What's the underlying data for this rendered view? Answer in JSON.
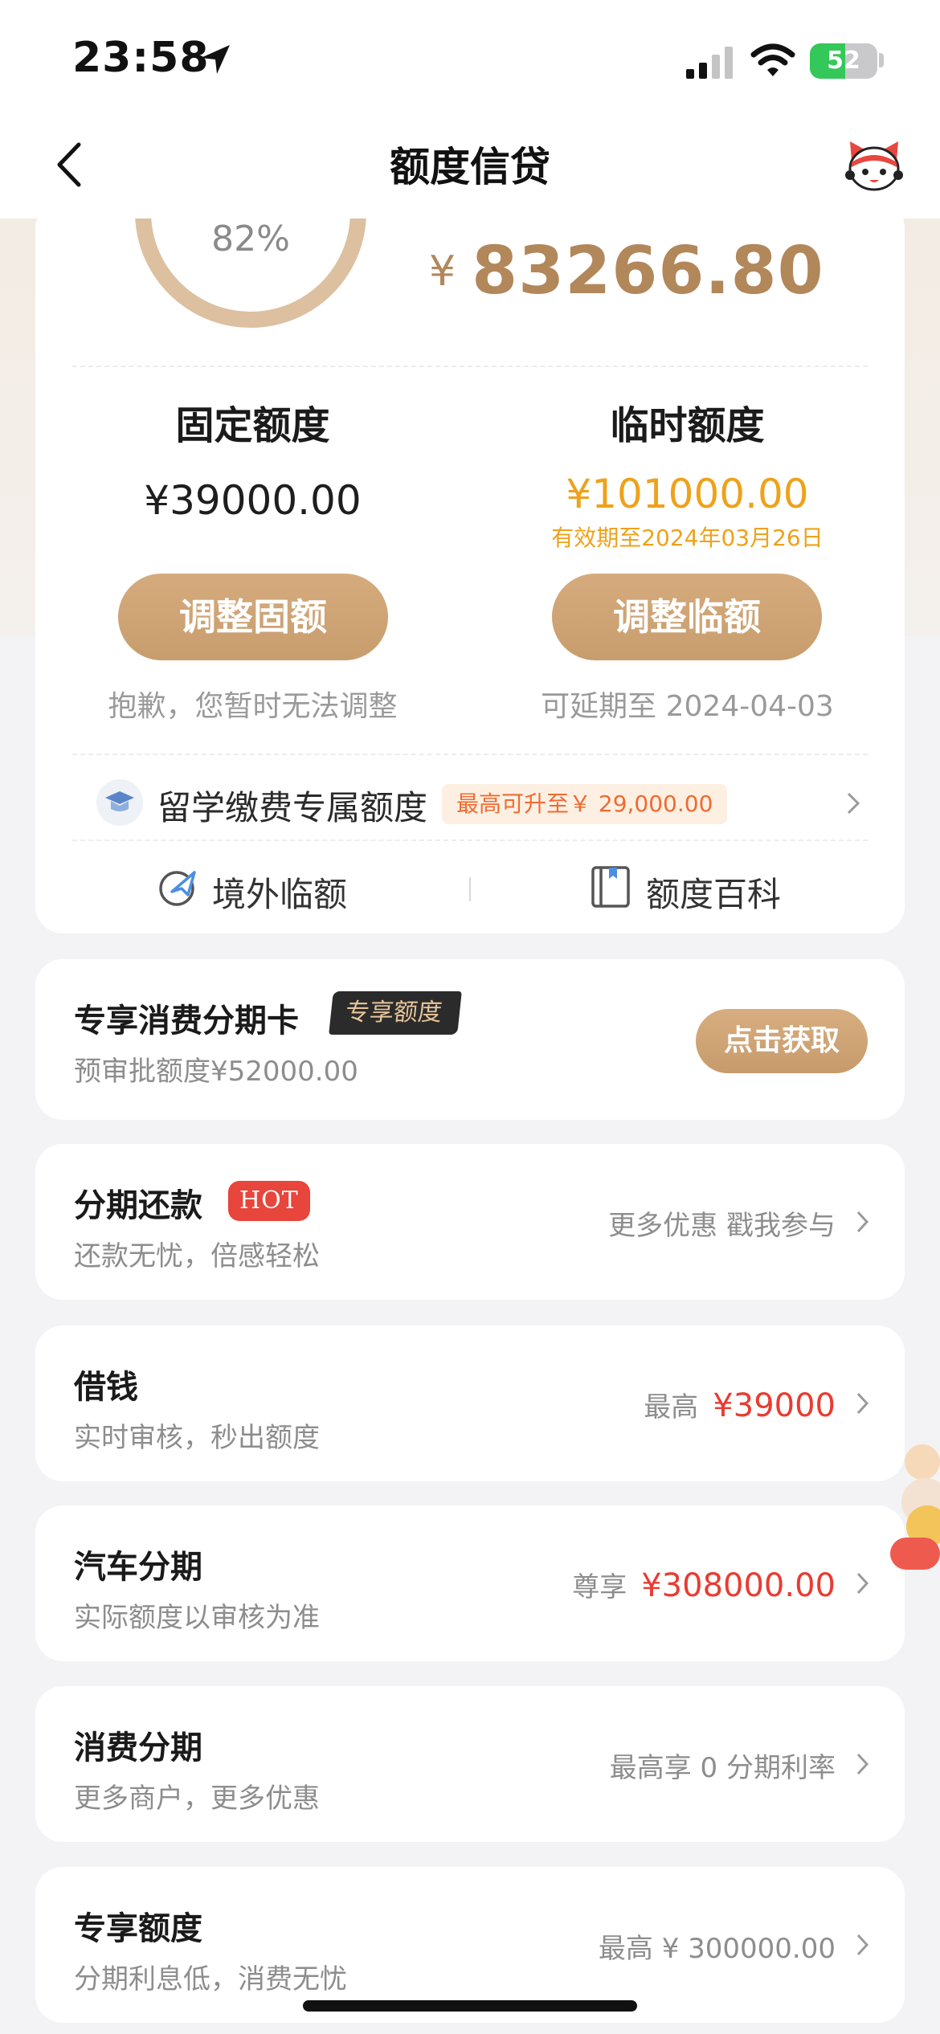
{
  "status_bar": {
    "time": "23:58",
    "battery": "52",
    "battery_level": 0.52
  },
  "nav": {
    "title": "额度信贷"
  },
  "quota": {
    "ring_percent": "82%",
    "ring_level": 0.82,
    "available_symbol": "¥",
    "available_amount": "83266.80",
    "fixed": {
      "label": "固定额度",
      "amount": "¥39000.00",
      "button": "调整固额",
      "note": "抱歉，您暂时无法调整"
    },
    "temp": {
      "label": "临时额度",
      "amount": "¥101000.00",
      "expire": "有效期至2024年03月26日",
      "button": "调整临额",
      "note": "可延期至 2024-04-03"
    },
    "study": {
      "label": "留学缴费专属额度",
      "tag": "最高可升至￥ 29,000.00"
    },
    "links": {
      "overseas": "境外临额",
      "encyclopedia": "额度百科"
    }
  },
  "installment_card": {
    "title": "专享消费分期卡",
    "badge": "专享额度",
    "sub": "预审批额度¥52000.00",
    "button": "点击获取"
  },
  "rows": [
    {
      "title": "分期还款",
      "badge": "HOT",
      "sub": "还款无忧，倍感轻松",
      "right_text": "更多优惠 戳我参与",
      "right_value": ""
    },
    {
      "title": "借钱",
      "sub": "实时审核，秒出额度",
      "right_text": "最高",
      "right_value": "¥39000"
    },
    {
      "title": "汽车分期",
      "sub": "实际额度以审核为准",
      "right_text": "尊享",
      "right_value": "¥308000.00"
    },
    {
      "title": "消费分期",
      "sub": "更多商户，更多优惠",
      "right_text": "最高享 0 分期利率",
      "right_value": ""
    },
    {
      "title": "专享额度",
      "sub": "分期利息低，消费无忧",
      "right_text": "最高 ¥ 300000.00",
      "right_value": ""
    }
  ],
  "colors": {
    "gold": "#b2875a",
    "accent_orange": "#eea21b",
    "red": "#ea3b32",
    "button_tan": "#cda274"
  }
}
